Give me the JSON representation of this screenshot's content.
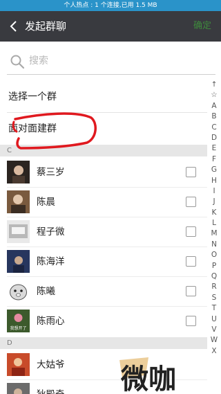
{
  "status_bar": {
    "text": "个人热点 : 1 个连接,已用 1.5 MB"
  },
  "header": {
    "title": "发起群聊",
    "confirm_label": "确定"
  },
  "search": {
    "placeholder": "搜索"
  },
  "options": [
    {
      "label": "选择一个群"
    },
    {
      "label": "面对面建群"
    }
  ],
  "sections": [
    {
      "letter": "C",
      "contacts": [
        {
          "name": "蔡三岁",
          "avatar_color": "#2b2420"
        },
        {
          "name": "陈晨",
          "avatar_color": "#7a5a3e"
        },
        {
          "name": "程子微",
          "avatar_color": "#b9b9b9"
        },
        {
          "name": "陈海洋",
          "avatar_color": "#27365e"
        },
        {
          "name": "陈曦",
          "avatar_color": "#dadada"
        },
        {
          "name": "陈雨心",
          "avatar_color": "#3c5a2c",
          "avatar_caption": "我想开了"
        }
      ]
    },
    {
      "letter": "D",
      "contacts": [
        {
          "name": "大姑爷",
          "avatar_color": "#c84b2a"
        },
        {
          "name": "狄殿奇",
          "avatar_color": "#6b6b6b"
        }
      ]
    }
  ],
  "index_letters": [
    "↑",
    "☆",
    "A",
    "B",
    "C",
    "D",
    "E",
    "F",
    "G",
    "H",
    "I",
    "J",
    "K",
    "L",
    "M",
    "N",
    "O",
    "P",
    "Q",
    "R",
    "S",
    "T",
    "U",
    "V",
    "W",
    "X"
  ],
  "watermark": {
    "text": "微咖"
  },
  "colors": {
    "title_bar": "#393a3f",
    "status_bar": "#2a93c9",
    "confirm": "#3e8a3c",
    "annotation": "#e0191f"
  }
}
